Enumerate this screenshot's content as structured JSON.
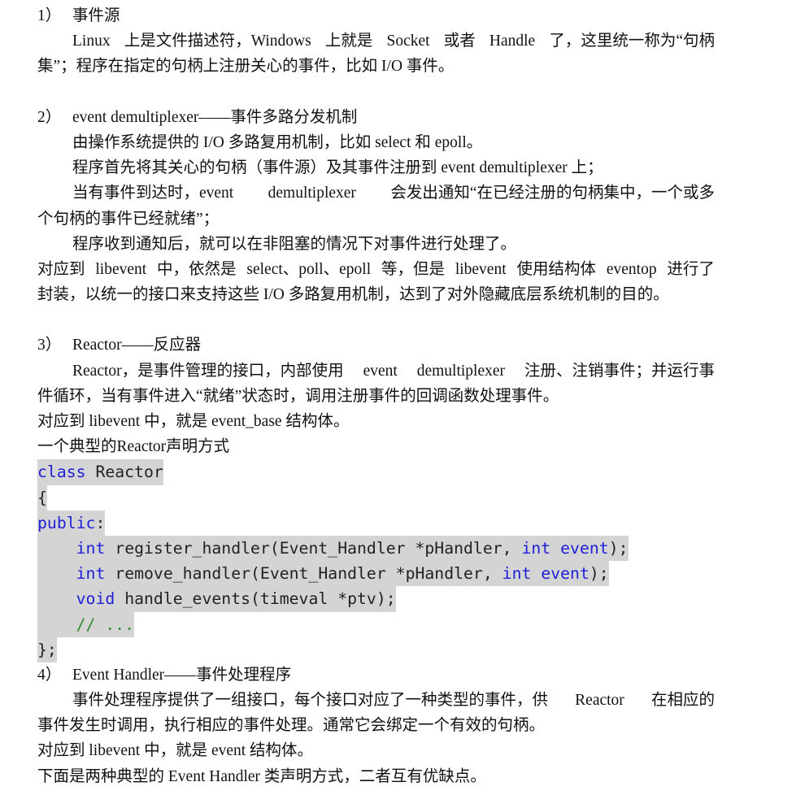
{
  "sections": {
    "s1": {
      "number": "1）",
      "title": "事件源",
      "p1_line1_words": [
        "Linux",
        "上是文件描述符，Windows",
        "上就是",
        "Socket",
        "或者",
        "Handle",
        "了，这里统一称为“句柄"
      ],
      "p1_line2": "集”；程序在指定的句柄上注册关心的事件，比如 I/O 事件。"
    },
    "s2": {
      "number": "2）",
      "title": "event demultiplexer——事件多路分发机制",
      "l1": "由操作系统提供的 I/O 多路复用机制，比如 select 和 epoll。",
      "l2": "程序首先将其关心的句柄（事件源）及其事件注册到 event demultiplexer 上；",
      "l3_words": [
        "当有事件到达时，event",
        "demultiplexer",
        "会发出通知“在已经注册的句柄集中，一个或多"
      ],
      "l4": "个句柄的事件已经就绪”；",
      "l5": "程序收到通知后，就可以在非阻塞的情况下对事件进行处理了。",
      "l6_words": [
        "对应到",
        "libevent",
        "中，依然是",
        "select、poll、epoll",
        "等，但是",
        "libevent",
        "使用结构体",
        "eventop",
        "进行了"
      ],
      "l7": "封装，以统一的接口来支持这些 I/O 多路复用机制，达到了对外隐藏底层系统机制的目的。"
    },
    "s3": {
      "number": "3）",
      "title": "Reactor——反应器",
      "l1_words": [
        "Reactor，是事件管理的接口，内部使用",
        "event",
        "demultiplexer",
        "注册、注销事件；并运行事"
      ],
      "l2": "件循环，当有事件进入“就绪”状态时，调用注册事件的回调函数处理事件。",
      "l3": "对应到 libevent 中，就是 event_base 结构体。",
      "l4": "一个典型的Reactor声明方式"
    },
    "code": {
      "c1_kw": "class",
      "c1_tx": " Reactor",
      "c2": "{",
      "c3_kw": "public",
      "c3_tx": ":",
      "c4_indent": "    ",
      "c4_kw1": "int",
      "c4_tx1": " register_handler(Event_Handler *pHandler, ",
      "c4_kw2": "int",
      "c4_sp": " ",
      "c4_kw3": "event",
      "c4_tx2": ");",
      "c5_indent": "    ",
      "c5_kw1": "int",
      "c5_tx1": " remove_handler(Event_Handler *pHandler, ",
      "c5_kw2": "int",
      "c5_sp": " ",
      "c5_kw3": "event",
      "c5_tx2": ");",
      "c6_indent": "    ",
      "c6_kw": "void",
      "c6_tx": " handle_events(timeval *ptv);",
      "c7_indent": "    ",
      "c7_cm": "// ...",
      "c8": "};"
    },
    "s4": {
      "number": "4）",
      "title": "Event Handler——事件处理程序",
      "l1_words": [
        "事件处理程序提供了一组接口，每个接口对应了一种类型的事件，供",
        "Reactor",
        "在相应的"
      ],
      "l2": "事件发生时调用，执行相应的事件处理。通常它会绑定一个有效的句柄。",
      "l3": "对应到 libevent 中，就是 event 结构体。",
      "l4": "下面是两种典型的 Event Handler 类声明方式，二者互有优缺点。"
    }
  }
}
